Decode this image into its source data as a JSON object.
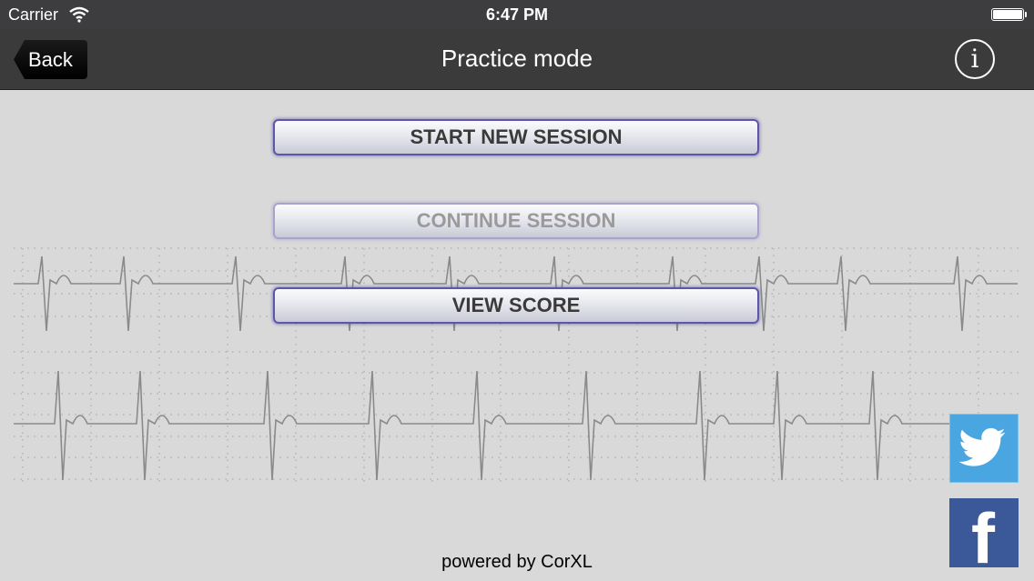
{
  "status_bar": {
    "carrier": "Carrier",
    "time": "6:47 PM",
    "wifi_icon": "wifi-icon",
    "battery_icon": "battery-icon"
  },
  "nav_bar": {
    "back_label": "Back",
    "title": "Practice mode",
    "info_label": "i"
  },
  "buttons": {
    "start_new_session": "START NEW SESSION",
    "continue_session": "CONTINUE SESSION",
    "view_score": "VIEW SCORE"
  },
  "social": {
    "twitter_icon": "twitter-bird-icon",
    "facebook_icon": "facebook-f-icon",
    "facebook_glyph": "f"
  },
  "footer": {
    "powered_by": "powered by CorXL"
  },
  "colors": {
    "status_bar": "#3d3d3f",
    "nav_bar": "#3b3b3b",
    "background": "#d9d9d9",
    "button_border": "#5e56a8",
    "twitter": "#4aa6e0",
    "facebook": "#3b5998"
  }
}
